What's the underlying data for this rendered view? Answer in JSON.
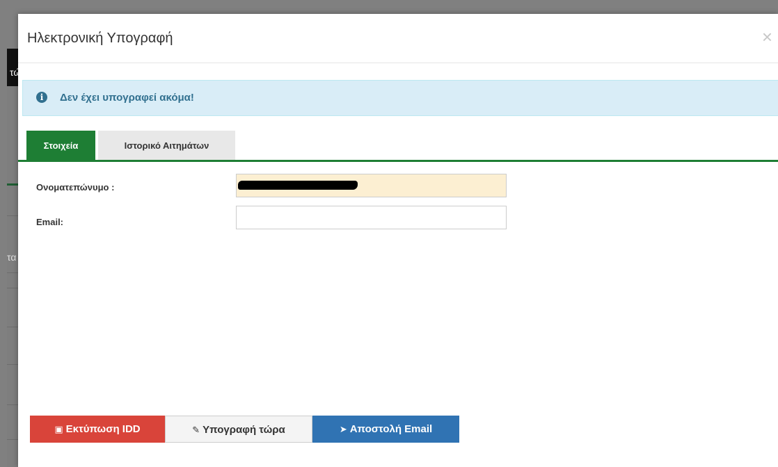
{
  "background": {
    "fragment_top": "τώ",
    "fragment_mid": "τα"
  },
  "modal": {
    "title": "Ηλεκτρονική Υπογραφή",
    "close_label": "×"
  },
  "alert": {
    "icon": "info-icon",
    "text": "Δεν έχει υπογραφεί ακόμα!"
  },
  "tabs": [
    {
      "label": "Στοιχεία",
      "active": true
    },
    {
      "label": "Ιστορικό Αιτημάτων",
      "active": false
    }
  ],
  "form": {
    "name_label": "Ονοματεπώνυμο :",
    "name_value": "",
    "email_label": "Email:",
    "email_value": ""
  },
  "buttons": {
    "print": {
      "label": "Εκτύπωση IDD",
      "icon": "pdf-icon",
      "color": "#d9443a"
    },
    "sign": {
      "label": "Υπογραφή τώρα",
      "icon": "edit-icon",
      "color": "#f4f4f4"
    },
    "email": {
      "label": "Αποστολή Email",
      "icon": "send-icon",
      "color": "#3073b3"
    }
  },
  "colors": {
    "accent_green": "#1e7e34",
    "alert_bg": "#d9edf7",
    "alert_text": "#31708f"
  }
}
